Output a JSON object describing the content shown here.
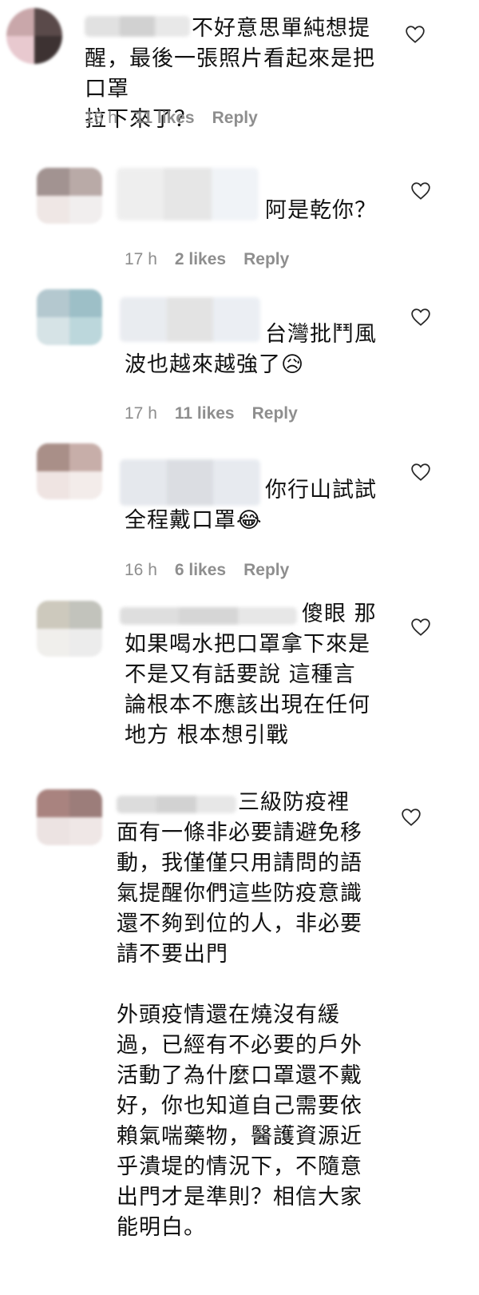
{
  "comments": [
    {
      "text": "不好意思單純想提\n醒，最後一張照片看起來是把口罩\n拉下來了？",
      "time": "18 h",
      "likes": "11 likes",
      "reply": "Reply"
    },
    {
      "text": "阿是乾你？",
      "time": "17 h",
      "likes": "2 likes",
      "reply": "Reply"
    },
    {
      "text": "台灣批鬥風\n波也越來越強了😥",
      "time": "17 h",
      "likes": "11 likes",
      "reply": "Reply"
    },
    {
      "text": "你行山試試\n全程戴口罩😂",
      "time": "16 h",
      "likes": "6 likes",
      "reply": "Reply"
    },
    {
      "text": "傻眼 那\n如果喝水把口罩拿下來是\n不是又有話要說 這種言\n論根本不應該出現在任何\n地方 根本想引戰"
    },
    {
      "text": "三級防疫裡\n面有一條非必要請避免移\n動，我僅僅只用請問的語\n氣提醒你們這些防疫意識\n還不夠到位的人，非必要\n請不要出門\n\n外頭疫情還在燒沒有緩\n過，已經有不必要的戶外\n活動了為什麼口罩還不戴\n好，你也知道自己需要依\n賴氣喘藥物，醫護資源近\n乎潰堤的情況下，不隨意\n出門才是準則？相信大家\n能明白。"
    }
  ],
  "colors": {
    "meta": "#8e8e8e",
    "text": "#111111",
    "heart": "#262626"
  }
}
